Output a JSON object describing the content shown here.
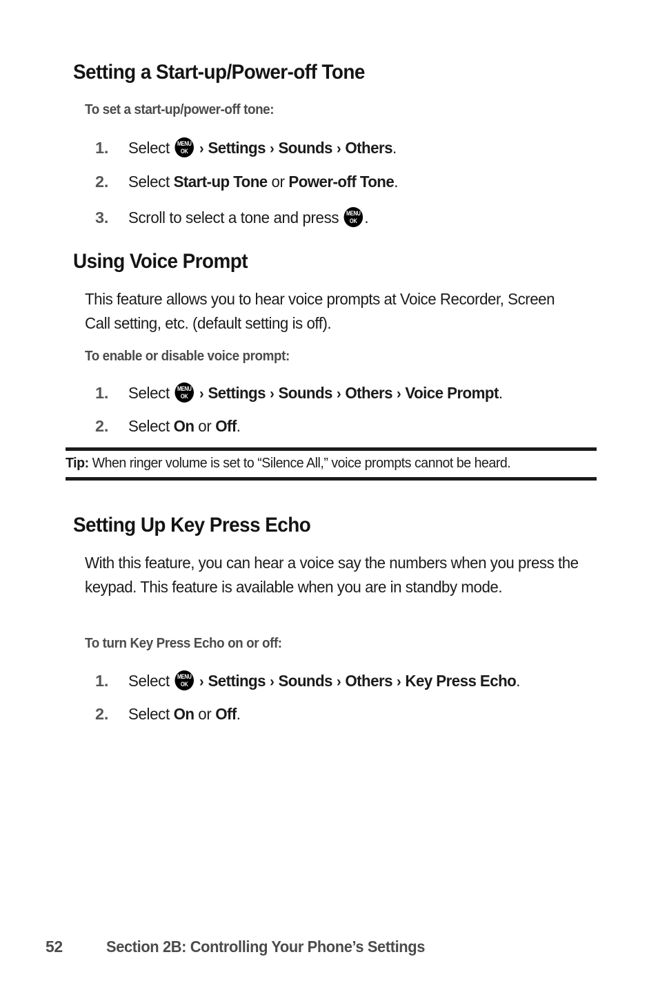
{
  "document": {
    "page_number": "52",
    "footer_section": "Section 2B: Controlling Your Phone’s Settings"
  },
  "icons": {
    "menu_key": {
      "line1": "MENU",
      "line2": "OK",
      "name": "menu-ok-key-icon"
    },
    "chevron": "›"
  },
  "sections": [
    {
      "heading": "Setting a Start-up/Power-off Tone",
      "procedure_heading": "To set a start-up/power-off tone:",
      "steps": [
        {
          "number": "1.",
          "parts": [
            {
              "t": "text",
              "v": "Select "
            },
            {
              "t": "key"
            },
            {
              "t": "chev"
            },
            {
              "t": "bold",
              "v": "Settings"
            },
            {
              "t": "chev"
            },
            {
              "t": "bold",
              "v": "Sounds"
            },
            {
              "t": "chev"
            },
            {
              "t": "bold",
              "v": "Others"
            },
            {
              "t": "text",
              "v": "."
            }
          ]
        },
        {
          "number": "2.",
          "parts": [
            {
              "t": "text",
              "v": "Select "
            },
            {
              "t": "bold",
              "v": "Start-up Tone"
            },
            {
              "t": "text",
              "v": " or "
            },
            {
              "t": "bold",
              "v": "Power-off Tone"
            },
            {
              "t": "text",
              "v": "."
            }
          ]
        },
        {
          "number": "3.",
          "parts": [
            {
              "t": "text",
              "v": "Scroll to select a tone and press "
            },
            {
              "t": "key"
            },
            {
              "t": "text",
              "v": "."
            }
          ]
        }
      ]
    },
    {
      "heading": "Using Voice Prompt",
      "paragraph": "This feature allows you to hear voice prompts at Voice Recorder, Screen Call setting, etc. (default setting is off).",
      "procedure_heading": "To enable or disable voice prompt:",
      "steps": [
        {
          "number": "1.",
          "parts": [
            {
              "t": "text",
              "v": "Select "
            },
            {
              "t": "key"
            },
            {
              "t": "chev"
            },
            {
              "t": "bold",
              "v": "Settings"
            },
            {
              "t": "chev"
            },
            {
              "t": "bold",
              "v": "Sounds"
            },
            {
              "t": "chev"
            },
            {
              "t": "bold",
              "v": "Others"
            },
            {
              "t": "chev"
            },
            {
              "t": "bold",
              "v": "Voice Prompt"
            },
            {
              "t": "text",
              "v": "."
            }
          ]
        },
        {
          "number": "2.",
          "parts": [
            {
              "t": "text",
              "v": "Select "
            },
            {
              "t": "bold",
              "v": "On"
            },
            {
              "t": "text",
              "v": " or "
            },
            {
              "t": "bold",
              "v": "Off"
            },
            {
              "t": "text",
              "v": "."
            }
          ]
        }
      ]
    },
    {
      "heading": "Setting Up Key Press Echo",
      "paragraph": "With this feature, you can hear a voice say the numbers when you press the keypad. This feature is available when you are in standby mode.",
      "procedure_heading": "To turn Key Press Echo on or off:",
      "steps": [
        {
          "number": "1.",
          "parts": [
            {
              "t": "text",
              "v": "Select "
            },
            {
              "t": "key"
            },
            {
              "t": "chev"
            },
            {
              "t": "bold",
              "v": "Settings"
            },
            {
              "t": "chev"
            },
            {
              "t": "bold",
              "v": "Sounds"
            },
            {
              "t": "chev"
            },
            {
              "t": "bold",
              "v": "Others"
            },
            {
              "t": "chev"
            },
            {
              "t": "bold",
              "v": "Key Press Echo"
            },
            {
              "t": "text",
              "v": "."
            }
          ]
        },
        {
          "number": "2.",
          "parts": [
            {
              "t": "text",
              "v": "Select "
            },
            {
              "t": "bold",
              "v": "On"
            },
            {
              "t": "text",
              "v": " or "
            },
            {
              "t": "bold",
              "v": "Off"
            },
            {
              "t": "text",
              "v": "."
            }
          ]
        }
      ]
    }
  ],
  "tip": {
    "label": "Tip:",
    "text": "When ringer volume is set to “Silence All,” voice prompts cannot be heard."
  },
  "colors": {
    "body_text": "#1b1b1b",
    "heading": "#141414",
    "subheading": "#4b4b4b",
    "step_number": "#575757",
    "rule": "#1b1b1b",
    "page_background": "#ffffff"
  }
}
